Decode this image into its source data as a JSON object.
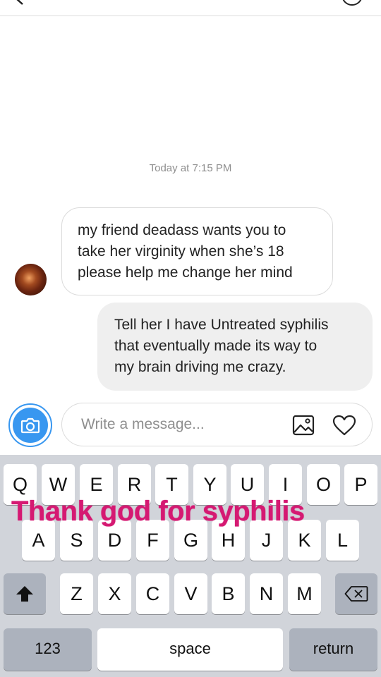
{
  "header": {
    "title": "",
    "back_icon": "chevron-left-icon",
    "info_icon": "info-icon"
  },
  "thread": {
    "timestamp": "Today at 7:15 PM",
    "messages": [
      {
        "direction": "incoming",
        "text": "my friend deadass wants you to\ntake her virginity when she’s 18\nplease help me change her mind"
      },
      {
        "direction": "outgoing",
        "text": "Tell her I have Untreated syphilis\nthat eventually made its way to\nmy brain driving me crazy."
      }
    ]
  },
  "composer": {
    "placeholder": "Write a message...",
    "camera_icon": "camera-icon",
    "gallery_icon": "image-icon",
    "heart_icon": "heart-icon"
  },
  "keyboard": {
    "row1": [
      "Q",
      "W",
      "E",
      "R",
      "T",
      "Y",
      "U",
      "I",
      "O",
      "P"
    ],
    "row2": [
      "A",
      "S",
      "D",
      "F",
      "G",
      "H",
      "J",
      "K",
      "L"
    ],
    "row3": [
      "Z",
      "X",
      "C",
      "V",
      "B",
      "N",
      "M"
    ],
    "numbers_label": "123",
    "space_label": "space",
    "return_label": "return",
    "shift_icon": "shift-icon",
    "backspace_icon": "backspace-icon"
  },
  "overlay": {
    "caption": "Thank god for syphilis",
    "color": "#d51972"
  },
  "colors": {
    "accent": "#3897f0",
    "bubble_outgoing": "#efefef",
    "keyboard_bg": "#d1d4da"
  }
}
